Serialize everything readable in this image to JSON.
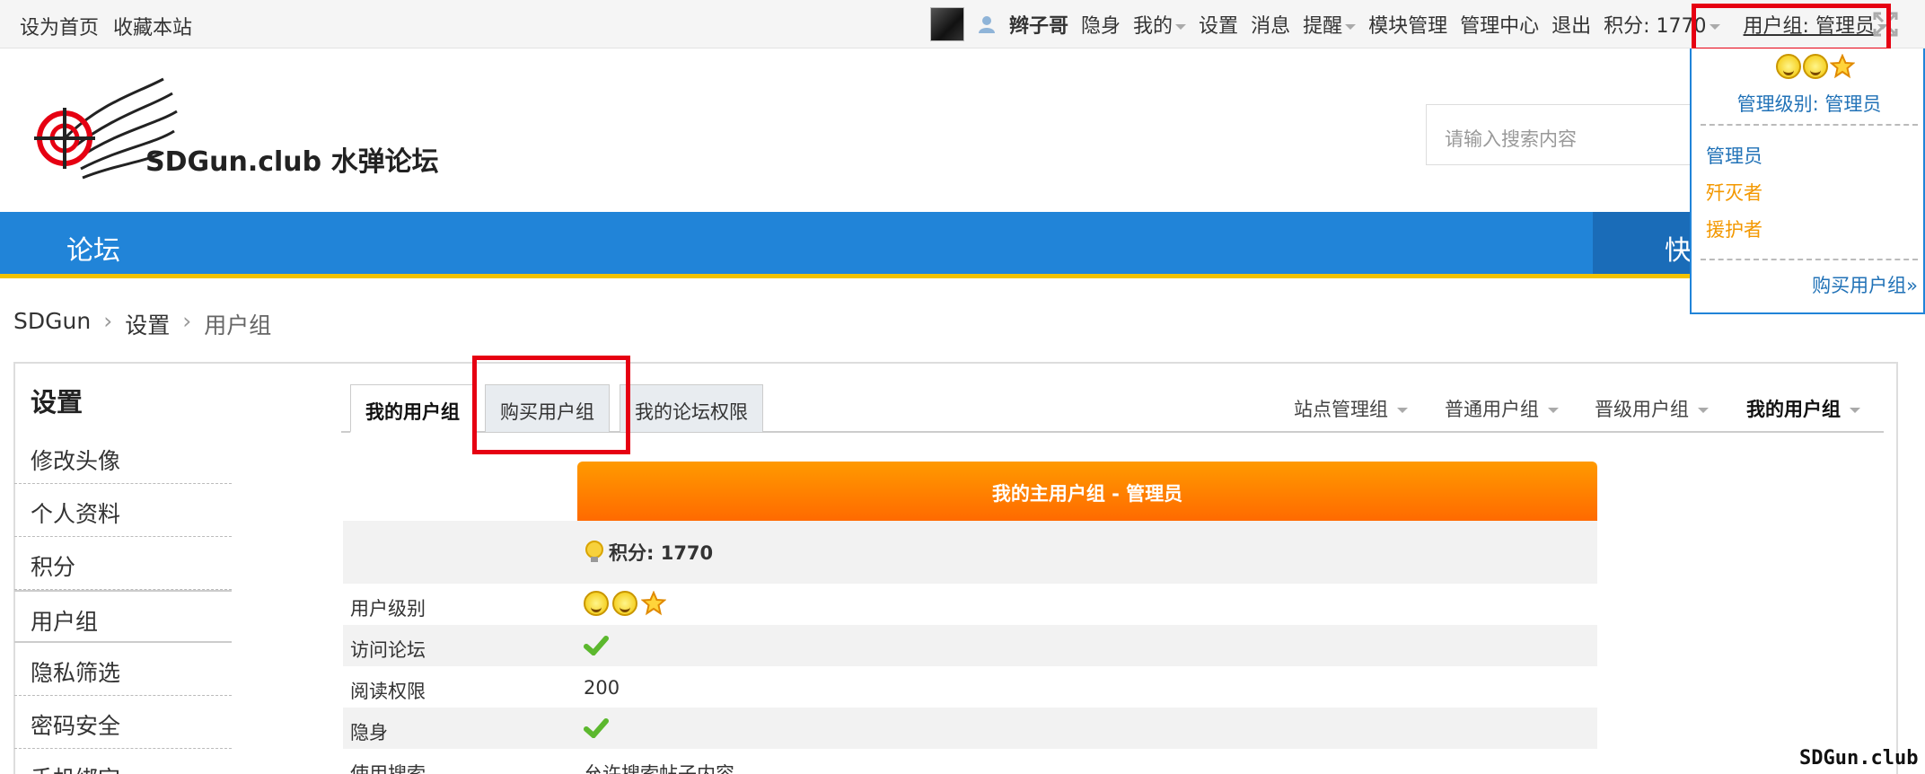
{
  "topbar": {
    "set_home": "设为首页",
    "bookmark": "收藏本站",
    "username": "辫子哥",
    "invisible": "隐身",
    "my": "我的",
    "settings": "设置",
    "messages": "消息",
    "reminders": "提醒",
    "module_admin": "模块管理",
    "admin_center": "管理中心",
    "logout": "退出",
    "points": "积分: 1770",
    "usergroup": "用户组: 管理员"
  },
  "header": {
    "logo_text": "SDGun.club 水弹论坛",
    "search_placeholder": "请输入搜索内容"
  },
  "nav": {
    "forum": "论坛",
    "quick": "快"
  },
  "breadcrumb": [
    "SDGun",
    "设置",
    "用户组"
  ],
  "sidebar": {
    "title": "设置",
    "items": [
      "修改头像",
      "个人资料",
      "积分",
      "用户组",
      "隐私筛选",
      "密码安全",
      "手机绑定"
    ]
  },
  "tabs": [
    "我的用户组",
    "购买用户组",
    "我的论坛权限"
  ],
  "right_tabs": [
    "站点管理组",
    "普通用户组",
    "晋级用户组",
    "我的用户组"
  ],
  "group_table": {
    "header": "我的主用户组 - 管理员",
    "points": "积分: 1770",
    "rows": [
      {
        "label": "用户级别",
        "value": ""
      },
      {
        "label": "访问论坛",
        "value": ""
      },
      {
        "label": "阅读权限",
        "value": "200"
      },
      {
        "label": "隐身",
        "value": ""
      },
      {
        "label": "使用搜索",
        "value": "允许搜索帖子内容"
      }
    ]
  },
  "dropdown": {
    "level": "管理级别: 管理员",
    "groups": [
      "管理员",
      "歼灭者",
      "援护者"
    ],
    "buy": "购买用户组»",
    "colors": {
      "admin": "#2172b7",
      "other": "#f39800"
    }
  },
  "watermark": "SDGun.club"
}
